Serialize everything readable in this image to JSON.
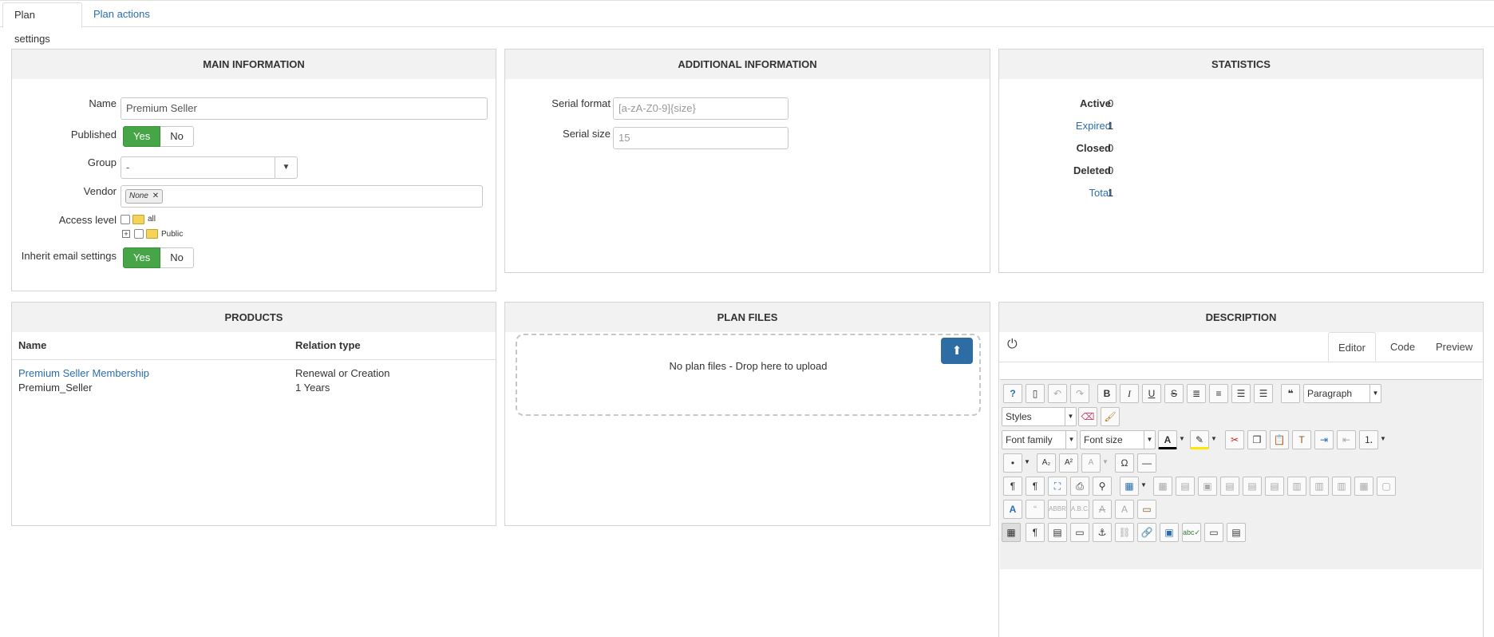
{
  "tabs": {
    "settings": "Plan settings",
    "actions": "Plan actions"
  },
  "main": {
    "title": "MAIN INFORMATION",
    "name_label": "Name",
    "name_value": "Premium Seller",
    "published_label": "Published",
    "yes": "Yes",
    "no": "No",
    "group_label": "Group",
    "group_value": "-",
    "vendor_label": "Vendor",
    "vendor_tag": "None",
    "access_label": "Access level",
    "access_all": "all",
    "access_public": "Public",
    "inherit_label": "Inherit email settings"
  },
  "additional": {
    "title": "ADDITIONAL INFORMATION",
    "serial_format_label": "Serial format",
    "serial_format_placeholder": "[a-zA-Z0-9]{size}",
    "serial_size_label": "Serial size",
    "serial_size_placeholder": "15"
  },
  "statistics": {
    "title": "STATISTICS",
    "active_label": "Active",
    "active_value": "0",
    "expired_label": "Expired",
    "expired_value": "1",
    "closed_label": "Closed",
    "closed_value": "0",
    "deleted_label": "Deleted",
    "deleted_value": "0",
    "total_label": "Total",
    "total_value": "1"
  },
  "products": {
    "title": "PRODUCTS",
    "col_name": "Name",
    "col_relation": "Relation type",
    "row_name": "Premium Seller Membership",
    "row_sub": "Premium_Seller",
    "row_relation": "Renewal or Creation",
    "row_duration": "1 Years"
  },
  "plan_files": {
    "title": "PLAN FILES",
    "empty": "No plan files - Drop here to upload"
  },
  "description": {
    "title": "DESCRIPTION",
    "tab_editor": "Editor",
    "tab_code": "Code",
    "tab_preview": "Preview",
    "paragraph": "Paragraph",
    "styles": "Styles",
    "font_family": "Font family",
    "font_size": "Font size"
  },
  "colors": {
    "accent": "#2a6db0",
    "yes_green": "#46a546",
    "upload_blue": "#2e6da4"
  }
}
